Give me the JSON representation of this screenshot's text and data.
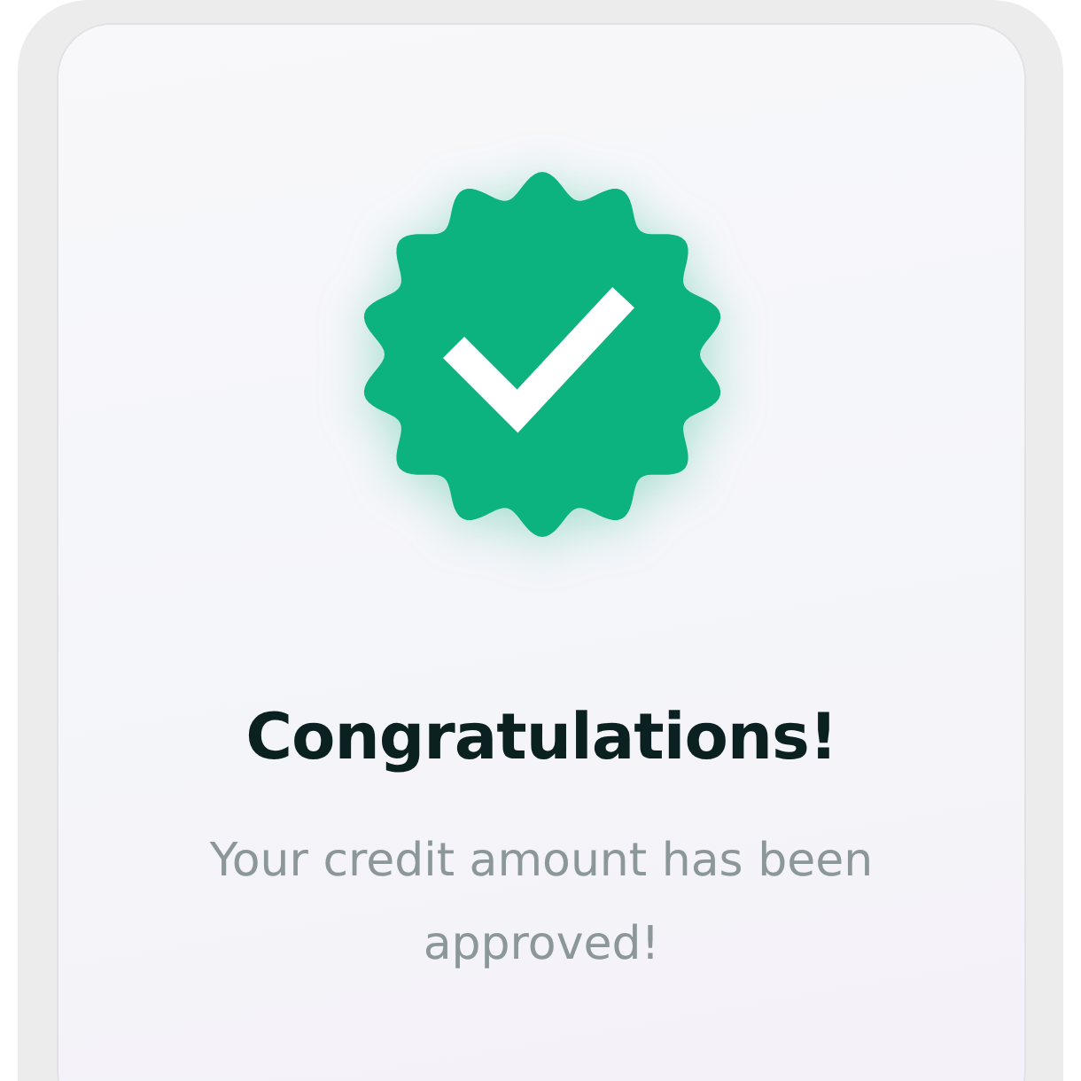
{
  "card": {
    "title": "Congratulations!",
    "message": "Your credit amount has been approved!"
  }
}
